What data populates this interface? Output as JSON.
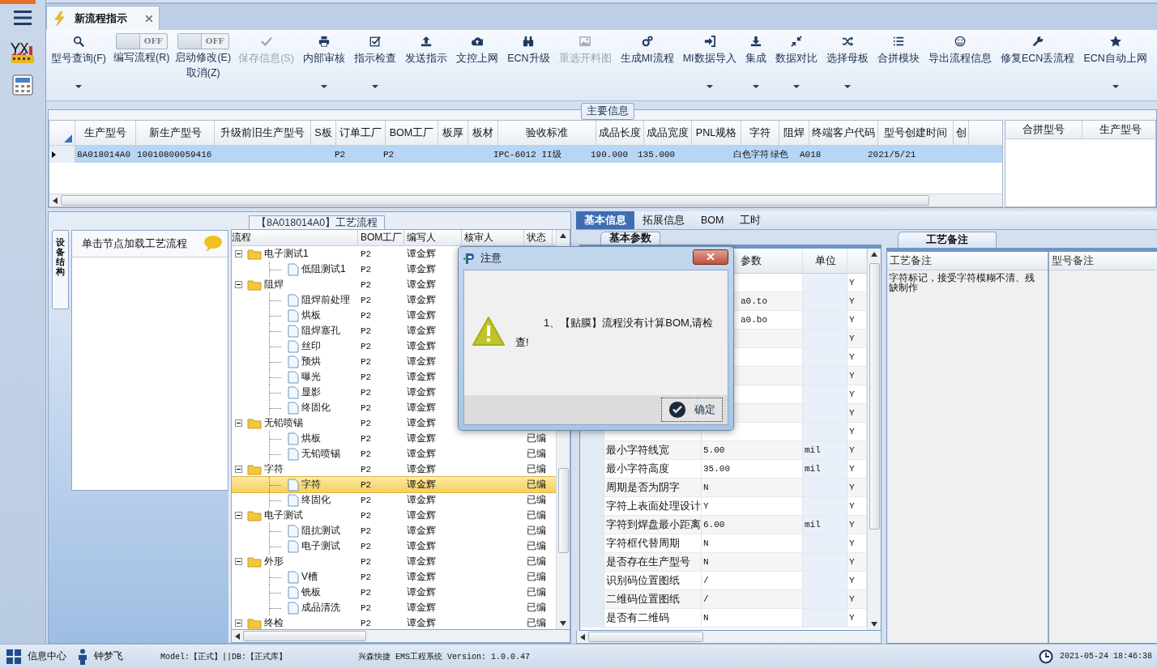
{
  "tab": {
    "title": "新流程指示"
  },
  "toolbar": [
    {
      "kind": "button",
      "label": "型号查询(F)",
      "dropdown": true,
      "disabled": false
    },
    {
      "kind": "toggle",
      "label": "编写流程(R)",
      "state_text": "OFF",
      "on": false
    },
    {
      "kind": "toggle",
      "label": "启动修改(E)",
      "sublabel": "取消(Z)",
      "state_text": "OFF",
      "on": false
    },
    {
      "kind": "button",
      "label": "保存信息(S)",
      "dropdown": false,
      "disabled": true
    },
    {
      "kind": "button",
      "label": "内部审核",
      "dropdown": true,
      "disabled": false
    },
    {
      "kind": "button",
      "label": "指示检查",
      "dropdown": true,
      "disabled": false
    },
    {
      "kind": "button",
      "label": "发送指示",
      "dropdown": false,
      "disabled": false
    },
    {
      "kind": "button",
      "label": "文控上网",
      "dropdown": false,
      "disabled": false
    },
    {
      "kind": "button",
      "label": "ECN升级",
      "dropdown": false,
      "disabled": false
    },
    {
      "kind": "button",
      "label": "重选开料图",
      "dropdown": false,
      "disabled": true
    },
    {
      "kind": "button",
      "label": "生成MI流程",
      "dropdown": false,
      "disabled": false
    },
    {
      "kind": "button",
      "label": "MI数据导入",
      "dropdown": true,
      "disabled": false
    },
    {
      "kind": "button",
      "label": "集成",
      "dropdown": true,
      "disabled": false
    },
    {
      "kind": "button",
      "label": "数据对比",
      "dropdown": true,
      "disabled": false
    },
    {
      "kind": "button",
      "label": "选择母板",
      "dropdown": true,
      "disabled": false
    },
    {
      "kind": "button",
      "label": "合拼模块",
      "dropdown": false,
      "disabled": false
    },
    {
      "kind": "button",
      "label": "导出流程信息",
      "dropdown": false,
      "disabled": false
    },
    {
      "kind": "button",
      "label": "修复ECN丢流程",
      "dropdown": false,
      "disabled": false
    },
    {
      "kind": "button",
      "label": "ECN自动上网",
      "dropdown": true,
      "disabled": false
    }
  ],
  "main_info": {
    "legend": "主要信息",
    "columns": [
      "生产型号",
      "新生产型号",
      "升级前旧生产型号",
      "S板",
      "订单工厂",
      "BOM工厂",
      "板厚",
      "板材",
      "验收标准",
      "成品长度",
      "成品宽度",
      "PNL规格",
      "字符",
      "阻焊",
      "终端客户代码",
      "型号创建时间",
      "创"
    ],
    "rows": [
      {
        "selected": true,
        "cells": [
          "8A018014A0",
          "10010800059416",
          null,
          null,
          "P2",
          "P2",
          null,
          null,
          "IPC-6012 II级",
          "190.000",
          "135.000",
          null,
          "白色字符",
          "绿色",
          "A018",
          "2021/5/21",
          null
        ]
      }
    ],
    "side_columns": [
      "合拼型号",
      "生产型号"
    ]
  },
  "side_panel": {
    "tab": "设备结构",
    "header": "单击节点加载工艺流程"
  },
  "process": {
    "title": "【8A018014A0】工艺流程",
    "columns": [
      "流程",
      "BOM工厂",
      "编写人",
      "核审人",
      "状态"
    ],
    "tree": [
      {
        "name": "电子测试1",
        "kind": "folder",
        "expanded": true,
        "bom": "P2",
        "writer": "谭金辉",
        "selected": false,
        "children": [
          {
            "name": "低阻测试1",
            "kind": "file",
            "bom": "P2",
            "writer": "谭金辉",
            "selected": false
          }
        ]
      },
      {
        "name": "阻焊",
        "kind": "folder",
        "expanded": true,
        "bom": "P2",
        "writer": "谭金辉",
        "selected": false,
        "children": [
          {
            "name": "阻焊前处理",
            "kind": "file",
            "bom": "P2",
            "writer": "谭金辉",
            "selected": false
          },
          {
            "name": "烘板",
            "kind": "file",
            "bom": "P2",
            "writer": "谭金辉",
            "selected": false
          },
          {
            "name": "阻焊塞孔",
            "kind": "file",
            "bom": "P2",
            "writer": "谭金辉",
            "selected": false
          },
          {
            "name": "丝印",
            "kind": "file",
            "bom": "P2",
            "writer": "谭金辉",
            "selected": false
          },
          {
            "name": "预烘",
            "kind": "file",
            "bom": "P2",
            "writer": "谭金辉",
            "selected": false
          },
          {
            "name": "曝光",
            "kind": "file",
            "bom": "P2",
            "writer": "谭金辉",
            "selected": false
          },
          {
            "name": "显影",
            "kind": "file",
            "bom": "P2",
            "writer": "谭金辉",
            "selected": false
          },
          {
            "name": "终固化",
            "kind": "file",
            "bom": "P2",
            "writer": "谭金辉",
            "selected": false
          }
        ]
      },
      {
        "name": "无铅喷锡",
        "kind": "folder",
        "expanded": true,
        "bom": "P2",
        "writer": "谭金辉",
        "selected": false,
        "children": [
          {
            "name": "烘板",
            "kind": "file",
            "bom": "P2",
            "writer": "谭金辉",
            "status": "已编",
            "selected": false
          },
          {
            "name": "无铅喷锡",
            "kind": "file",
            "bom": "P2",
            "writer": "谭金辉",
            "status": "已编",
            "selected": false
          }
        ]
      },
      {
        "name": "字符",
        "kind": "folder",
        "expanded": true,
        "bom": "P2",
        "writer": "谭金辉",
        "status": "已编",
        "selected": false,
        "children": [
          {
            "name": "字符",
            "kind": "file",
            "bom": "P2",
            "writer": "谭金辉",
            "status": "已编",
            "selected": true
          },
          {
            "name": "终固化",
            "kind": "file",
            "bom": "P2",
            "writer": "谭金辉",
            "status": "已编",
            "selected": false
          }
        ]
      },
      {
        "name": "电子测试",
        "kind": "folder",
        "expanded": true,
        "bom": "P2",
        "writer": "谭金辉",
        "status": "已编",
        "selected": false,
        "children": [
          {
            "name": "阻抗测试",
            "kind": "file",
            "bom": "P2",
            "writer": "谭金辉",
            "status": "已编",
            "selected": false
          },
          {
            "name": "电子测试",
            "kind": "file",
            "bom": "P2",
            "writer": "谭金辉",
            "status": "已编",
            "selected": false
          }
        ]
      },
      {
        "name": "外形",
        "kind": "folder",
        "expanded": true,
        "bom": "P2",
        "writer": "谭金辉",
        "status": "已编",
        "selected": false,
        "children": [
          {
            "name": "V槽",
            "kind": "file",
            "bom": "P2",
            "writer": "谭金辉",
            "status": "已编",
            "selected": false
          },
          {
            "name": "铣板",
            "kind": "file",
            "bom": "P2",
            "writer": "谭金辉",
            "status": "已编",
            "selected": false
          },
          {
            "name": "成品清洗",
            "kind": "file",
            "bom": "P2",
            "writer": "谭金辉",
            "status": "已编",
            "selected": false
          }
        ]
      },
      {
        "name": "终检",
        "kind": "folder",
        "expanded": true,
        "bom": "P2",
        "writer": "谭金辉",
        "status": "已编",
        "selected": false
      }
    ]
  },
  "detail": {
    "tabs": [
      {
        "label": "基本信息",
        "selected": true
      },
      {
        "label": "拓展信息",
        "selected": false
      },
      {
        "label": "BOM",
        "selected": false
      },
      {
        "label": "工时",
        "selected": false
      }
    ],
    "params": {
      "tab": "基本参数",
      "value_header": "参数",
      "unit_header": "单位",
      "rows": [
        {
          "flag": "Y"
        },
        {
          "value": "a0.to",
          "flag": "Y"
        },
        {
          "value": "a0.bo",
          "flag": "Y"
        },
        {
          "flag": "Y"
        },
        {
          "flag": "Y"
        },
        {
          "flag": "Y"
        },
        {
          "flag": "Y"
        },
        {
          "flag": "Y"
        },
        {
          "flag": "Y"
        },
        {
          "name": "最小字符线宽",
          "value": "5.00",
          "unit": "mil",
          "flag": "Y"
        },
        {
          "name": "最小字符高度",
          "value": "35.00",
          "unit": "mil",
          "flag": "Y"
        },
        {
          "name": "周期是否为阴字",
          "value": "N",
          "flag": "Y"
        },
        {
          "name": "字符上表面处理设计",
          "value": "Y",
          "flag": "Y"
        },
        {
          "name": "字符到焊盘最小距离",
          "value": "6.00",
          "unit": "mil",
          "flag": "Y"
        },
        {
          "name": "字符框代替周期",
          "value": "N",
          "flag": "Y"
        },
        {
          "name": "是否存在生产型号",
          "value": "N",
          "flag": "Y"
        },
        {
          "name": "识别码位置图纸",
          "value": "/",
          "flag": "Y"
        },
        {
          "name": "二维码位置图纸",
          "value": "/",
          "flag": "Y"
        },
        {
          "name": "是否有二维码",
          "value": "N",
          "flag": "Y"
        }
      ]
    },
    "remarks": {
      "tab": "工艺备注",
      "process_header": "工艺备注",
      "model_header": "型号备注",
      "process_remark": "字符标记，接受字符模糊不清、残缺制作"
    }
  },
  "dialog": {
    "title": "注意",
    "message": "1、【贴膜】流程没有计算BOM,请检查!",
    "ok": "确定"
  },
  "status_bar": {
    "info_center": "信息中心",
    "user": "钟梦飞",
    "env": "Model:【正式】||DB:【正式库】",
    "system": "兴森快捷 EMS工程系统 Version: 1.0.0.47",
    "datetime": "2021-05-24 18:46:38"
  }
}
